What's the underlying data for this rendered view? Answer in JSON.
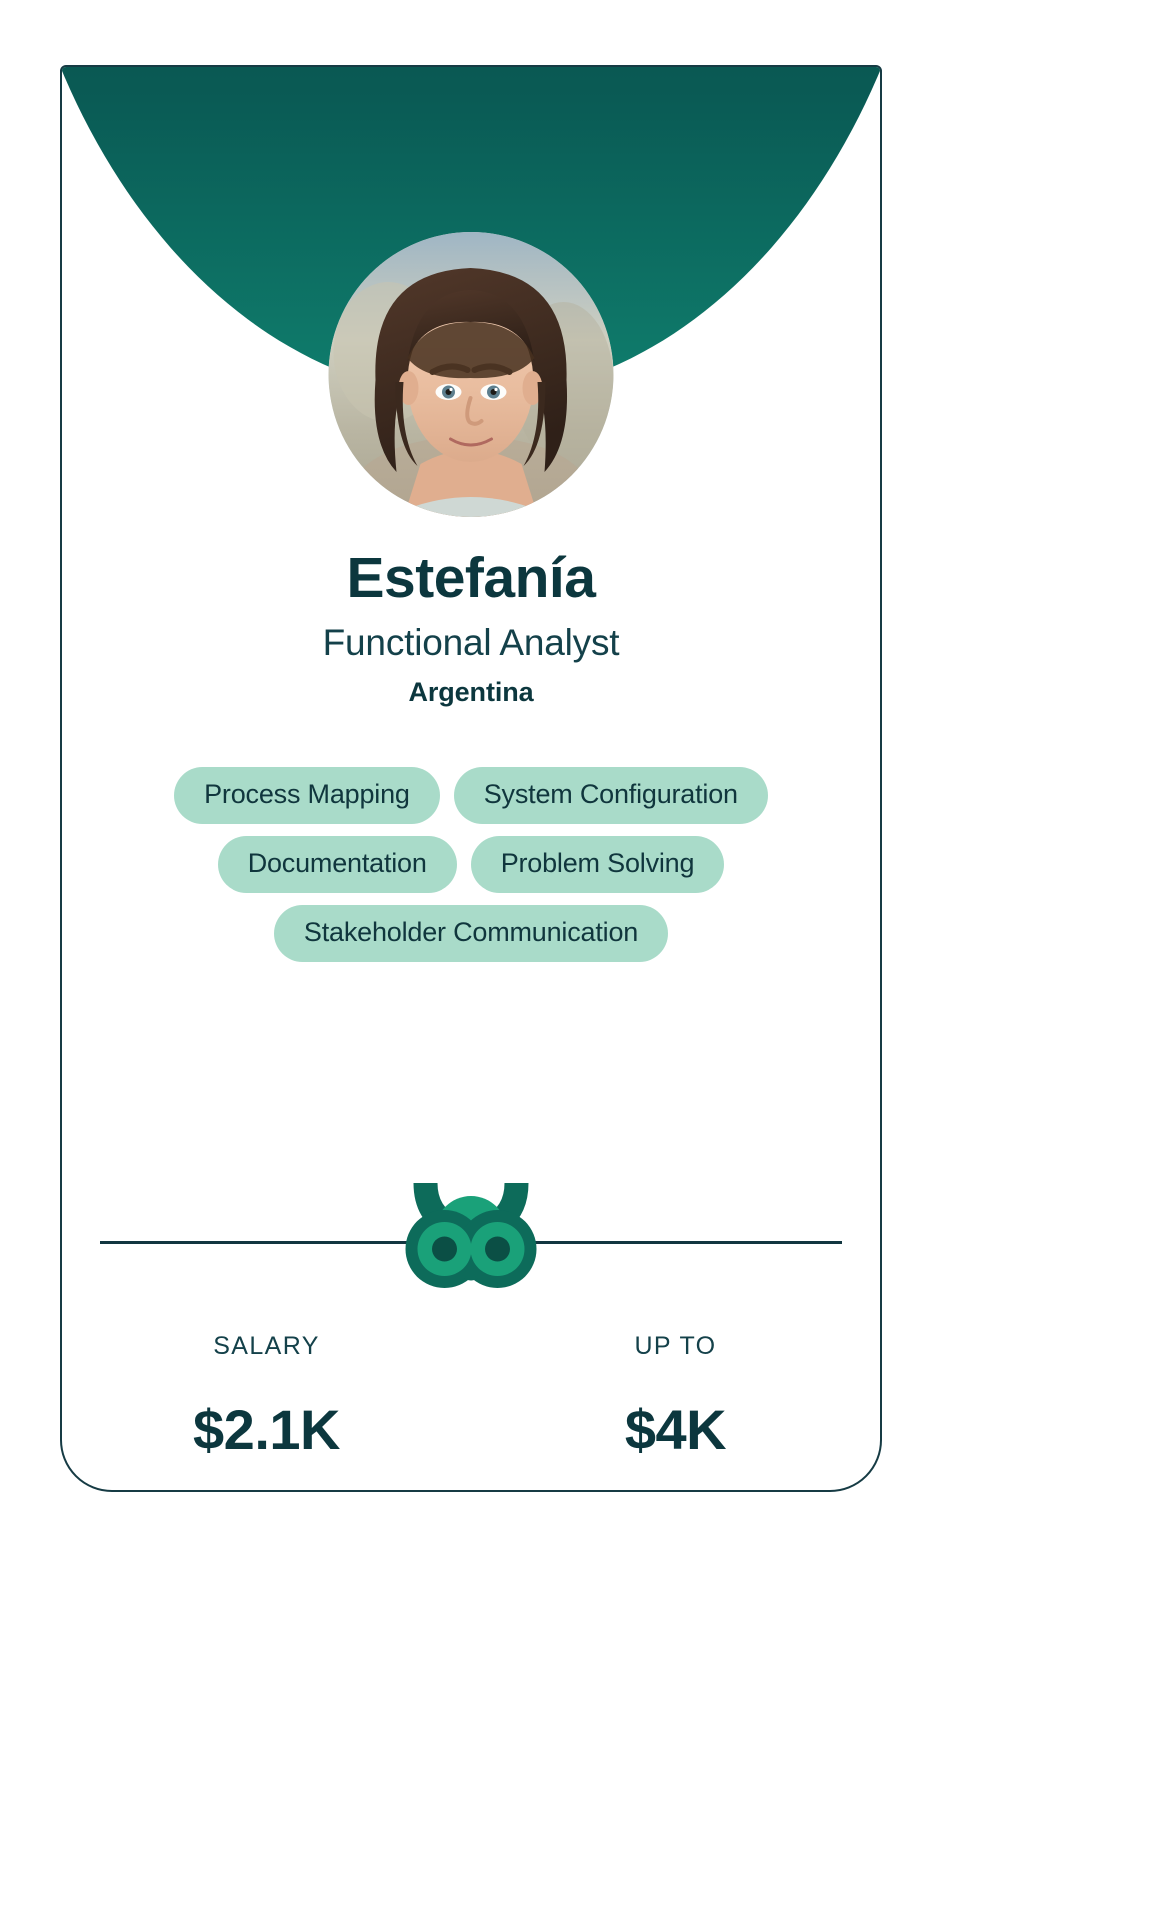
{
  "card": {
    "accent_teal_dark": "#07413f",
    "accent_teal_light": "#0f7e6d",
    "text_dark": "#0c373e",
    "pill_bg": "#a9dbc9",
    "border_color": "#163b44"
  },
  "avatar": {
    "icon": "avatar-photo",
    "alt": "Estefanía"
  },
  "profile": {
    "name": "Estefanía",
    "role": "Functional Analyst",
    "country": "Argentina"
  },
  "skills": {
    "rows": [
      [
        "Process Mapping",
        "System Configuration"
      ],
      [
        "Documentation",
        "Problem Solving"
      ],
      [
        "Stakeholder Communication"
      ]
    ]
  },
  "logo": {
    "icon": "owl-logo-icon",
    "ring_color": "#0d6b5a",
    "iris_color": "#1aa179",
    "pupil_color": "#0b4f45"
  },
  "compensation": {
    "columns": [
      {
        "label": "SALARY",
        "value": "$2.1K"
      },
      {
        "label": "UP TO",
        "value": "$4K"
      }
    ]
  }
}
